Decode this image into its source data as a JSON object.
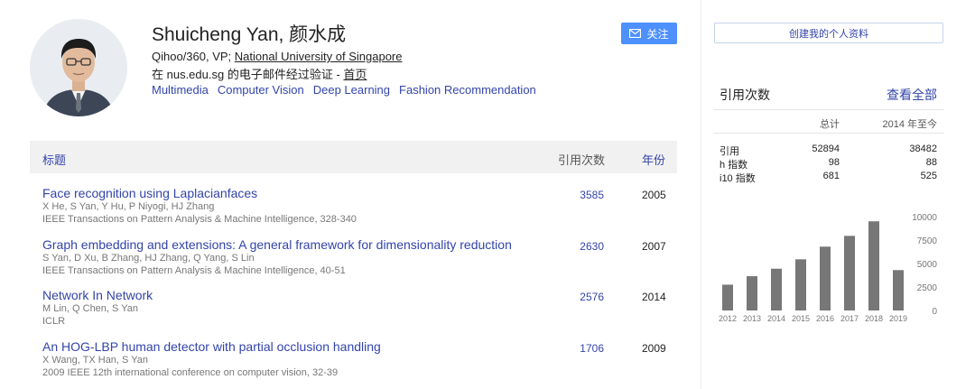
{
  "profile": {
    "name": "Shuicheng Yan, 颜水成",
    "affiliation_prefix": "Qihoo/360, VP; ",
    "affiliation_link": "National University of Singapore",
    "email_text": "在 nus.edu.sg 的电子邮件经过验证",
    "email_sep": " - ",
    "homepage": "首页",
    "interests": [
      "Multimedia",
      "Computer Vision",
      "Deep Learning",
      "Fashion Recommendation"
    ],
    "follow_label": "关注"
  },
  "table": {
    "header_title": "标题",
    "header_cites": "引用次数",
    "header_year": "年份",
    "articles": [
      {
        "title": "Face recognition using Laplacianfaces",
        "authors": "X He, S Yan, Y Hu, P Niyogi, HJ Zhang",
        "venue": "IEEE Transactions on Pattern Analysis & Machine Intelligence, 328-340",
        "cites": "3585",
        "year": "2005"
      },
      {
        "title": "Graph embedding and extensions: A general framework for dimensionality reduction",
        "authors": "S Yan, D Xu, B Zhang, HJ Zhang, Q Yang, S Lin",
        "venue": "IEEE Transactions on Pattern Analysis & Machine Intelligence, 40-51",
        "cites": "2630",
        "year": "2007"
      },
      {
        "title": "Network In Network",
        "authors": "M Lin, Q Chen, S Yan",
        "venue": "ICLR",
        "cites": "2576",
        "year": "2014"
      },
      {
        "title": "An HOG-LBP human detector with partial occlusion handling",
        "authors": "X Wang, TX Han, S Yan",
        "venue": "2009 IEEE 12th international conference on computer vision, 32-39",
        "cites": "1706",
        "year": "2009"
      }
    ]
  },
  "sidebar": {
    "create_profile": "创建我的个人资料",
    "cited_by": "引用次数",
    "view_all": "查看全部",
    "col_total": "总计",
    "col_since": "2014 年至今",
    "rows": [
      {
        "label": "引用",
        "total": "52894",
        "since": "38482"
      },
      {
        "label": "h 指数",
        "total": "98",
        "since": "88"
      },
      {
        "label": "i10 指数",
        "total": "681",
        "since": "525"
      }
    ]
  },
  "chart_data": {
    "type": "bar",
    "categories": [
      "2012",
      "2013",
      "2014",
      "2015",
      "2016",
      "2017",
      "2018",
      "2019"
    ],
    "values": [
      2750,
      3650,
      4450,
      5450,
      6800,
      7950,
      9500,
      4300
    ],
    "yticks": [
      "10000",
      "7500",
      "5000",
      "2500",
      "0"
    ],
    "ylim": [
      0,
      10000
    ],
    "bar_color": "#777777"
  },
  "colors": {
    "link": "#3344aa",
    "follow_button": "#4d90fe",
    "header_bg": "#f1f1f1"
  }
}
